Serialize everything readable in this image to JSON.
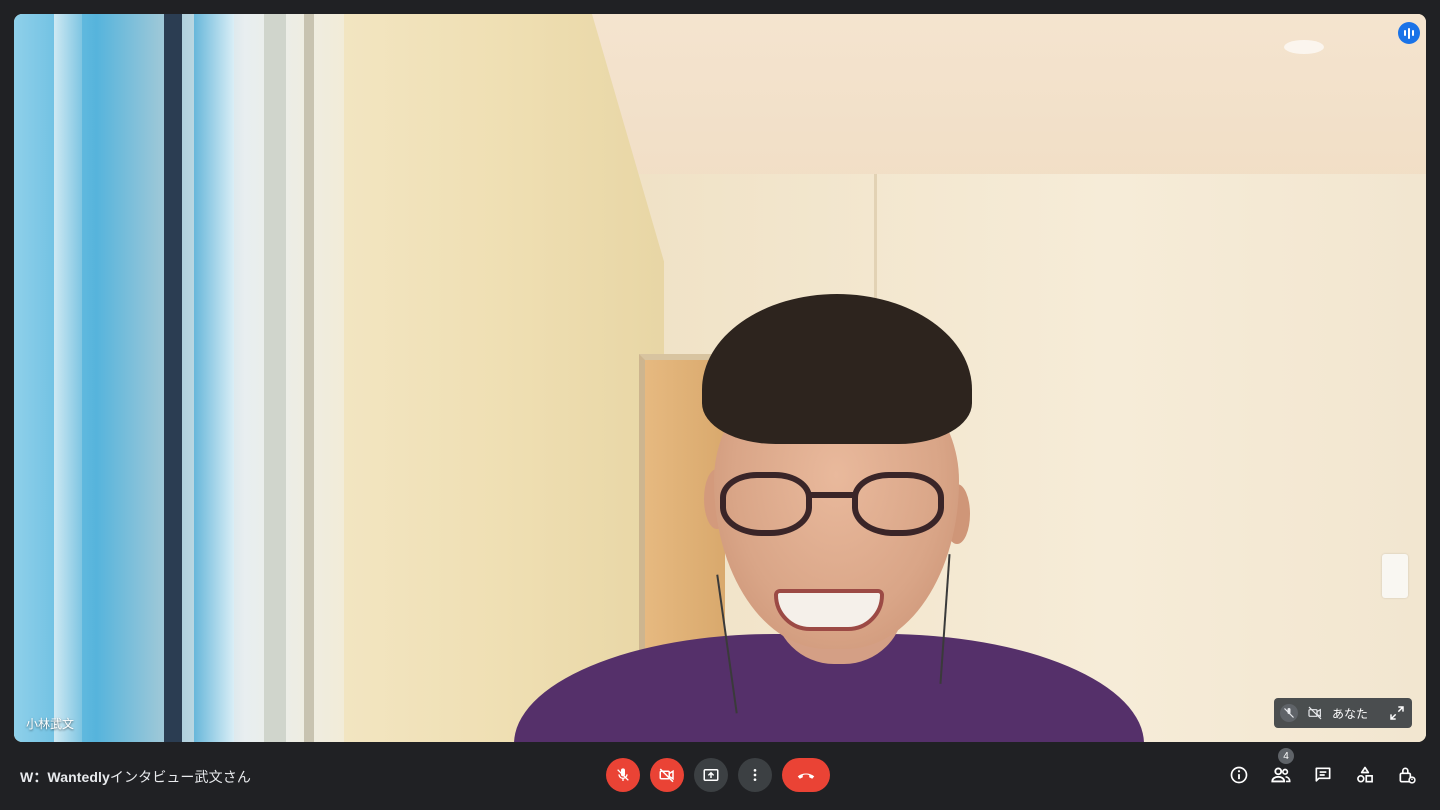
{
  "stage": {
    "speaker_name": "小林武文",
    "self_tile": {
      "name": "あなた"
    }
  },
  "bottombar": {
    "meeting_title_bold": "W：Wantedly",
    "meeting_title_rest": "インタビュー武文さん",
    "participants_count": "4"
  },
  "colors": {
    "background": "#202124",
    "control_dark": "#3c4043",
    "control_red": "#ea4335",
    "speaking_blue": "#1a73e8"
  },
  "icons": {
    "mic": "mic-off-icon",
    "camera": "videocam-off-icon",
    "present": "present-screen-icon",
    "more": "more-vert-icon",
    "hangup": "call-end-icon",
    "info": "info-icon",
    "people": "people-icon",
    "chat": "chat-icon",
    "activities": "activities-icon",
    "host": "lock-person-icon"
  }
}
